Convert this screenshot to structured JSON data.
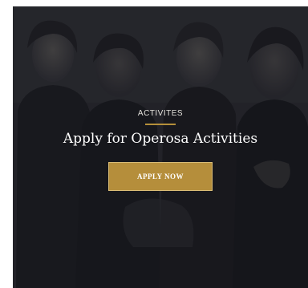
{
  "hero": {
    "eyebrow": "ACTIVITES",
    "title": "Apply for Operosa Activities",
    "button_label": "APPLY NOW",
    "background_image": "dark-group-photo",
    "colors": {
      "accent": "#b58e3b",
      "overlay": "#1c1d21",
      "text": "#ffffff"
    }
  }
}
